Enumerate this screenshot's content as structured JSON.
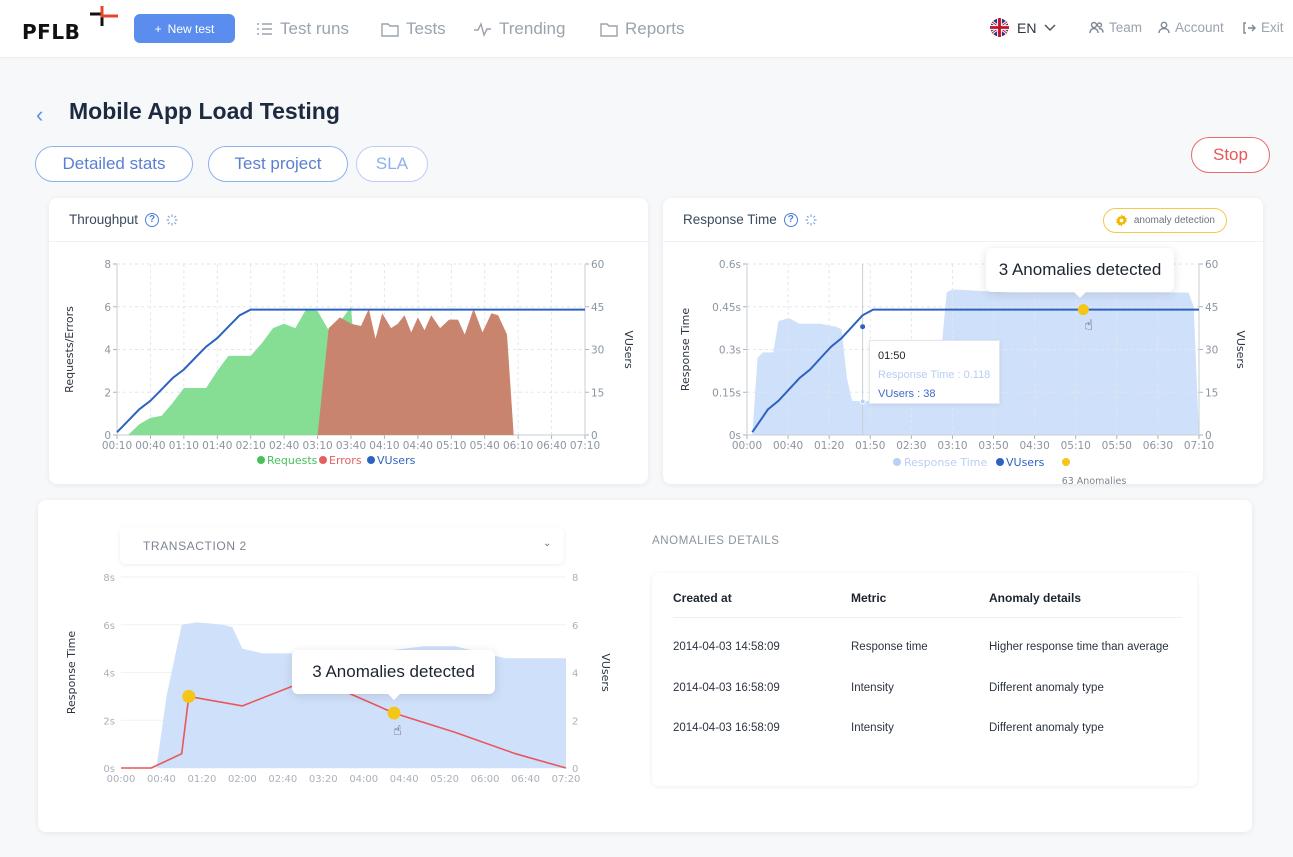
{
  "nav": {
    "logo": "PFLB",
    "new_test_label": "New test",
    "items": [
      {
        "label": "Test runs",
        "icon": "list-icon"
      },
      {
        "label": "Tests",
        "icon": "folder-icon"
      },
      {
        "label": "Trending",
        "icon": "pulse-icon"
      },
      {
        "label": "Reports",
        "icon": "folder-icon"
      }
    ],
    "language": "EN",
    "right_items": [
      {
        "label": "Team",
        "icon": "team-icon"
      },
      {
        "label": "Account",
        "icon": "user-icon"
      },
      {
        "label": "Exit",
        "icon": "exit-icon"
      }
    ]
  },
  "header": {
    "title": "Mobile App Load Testing",
    "tabs": [
      "Detailed stats",
      "Test project",
      "SLA"
    ],
    "stop_label": "Stop"
  },
  "throughput_card": {
    "title": "Throughput",
    "help": "?"
  },
  "response_card": {
    "title": "Response Time",
    "help": "?",
    "anomaly_badge": "anomaly detection",
    "anomalies_popup": "3 Anomalies detected",
    "tooltip": {
      "time": "01:50",
      "response_time": "Response Time : 0.118",
      "vusers": "VUsers : 38"
    },
    "anomalies_count_label": "63 Anomalies"
  },
  "transaction_card": {
    "selected_transaction": "TRANSACTION 2",
    "anomalies_popup": "3 Anomalies detected"
  },
  "anomalies_details": {
    "title": "ANOMALIES DETAILS",
    "columns": [
      "Created at",
      "Metric",
      "Anomaly details"
    ],
    "rows": [
      [
        "2014-04-03 14:58:09",
        "Response time",
        "Higher response time than average"
      ],
      [
        "2014-04-03 16:58:09",
        "Intensity",
        "Different anomaly type"
      ],
      [
        "2014-04-03 16:58:09",
        "Intensity",
        "Different anomaly type"
      ]
    ]
  },
  "colors": {
    "accent": "#5b8def",
    "requests": "#7fdc8f",
    "errors": "#c8846c",
    "vusers": "#2d63c0",
    "response_area": "#cfe0fa",
    "anomaly": "#f5c518",
    "stop": "#e65757",
    "transaction_line": "#e8575a"
  },
  "chart_data": [
    {
      "type": "area",
      "title": "Throughput",
      "xlabel": "",
      "ylabel": "Requests/Errors",
      "y2label": "VUsers",
      "ylim": [
        0,
        8
      ],
      "y2lim": [
        0,
        60
      ],
      "yticks": [
        "0",
        "2",
        "4",
        "6",
        "8"
      ],
      "y2ticks": [
        "0",
        "15",
        "30",
        "45",
        "60"
      ],
      "xticks": [
        "00:10",
        "00:40",
        "01:10",
        "01:40",
        "02:10",
        "02:40",
        "03:10",
        "03:40",
        "04:10",
        "04:40",
        "05:10",
        "05:40",
        "06:10",
        "06:40",
        "07:10"
      ],
      "x_minutes_range": [
        10,
        430
      ],
      "legend": [
        "Requests",
        "Errors",
        "VUsers"
      ],
      "legend_position": "bottom",
      "series": [
        {
          "name": "Requests",
          "axis": "left",
          "x": [
            20,
            30,
            40,
            50,
            60,
            70,
            80,
            90,
            100,
            110,
            120,
            130,
            140,
            150,
            160,
            170,
            180,
            190,
            200,
            210,
            220,
            229
          ],
          "values": [
            0,
            0.5,
            0.8,
            0.9,
            1.5,
            2.2,
            2.2,
            2.2,
            3.0,
            3.7,
            3.7,
            3.7,
            4.3,
            5.0,
            5.2,
            5.0,
            5.9,
            5.8,
            4.9,
            5.3,
            6.0,
            0
          ]
        },
        {
          "name": "Errors",
          "axis": "left",
          "x": [
            190,
            200,
            210,
            220,
            229,
            236,
            242,
            248,
            256,
            262,
            268,
            274,
            280,
            286,
            292,
            300,
            308,
            316,
            322,
            330,
            338,
            346,
            352,
            360,
            366,
            374,
            382,
            390,
            398,
            404,
            410,
            418,
            426
          ],
          "values": [
            0,
            5.0,
            5.5,
            5.2,
            5.1,
            5.9,
            4.5,
            5.7,
            5.0,
            5.2,
            5.6,
            4.8,
            5.5,
            4.9,
            5.6,
            5.0,
            5.4,
            5.4,
            4.7,
            5.9,
            4.8,
            5.7,
            5.6,
            4.7,
            0,
            0,
            0,
            0,
            0,
            0,
            0,
            0,
            0
          ]
        },
        {
          "name": "VUsers",
          "axis": "right",
          "x": [
            10,
            20,
            30,
            40,
            50,
            60,
            70,
            80,
            90,
            100,
            110,
            120,
            130,
            140,
            160,
            430
          ],
          "values": [
            1,
            5,
            9,
            12,
            16,
            20,
            23,
            27,
            31,
            34,
            38,
            42,
            44,
            44,
            44,
            44
          ]
        }
      ]
    },
    {
      "type": "area",
      "title": "Response Time",
      "ylabel": "Response Time",
      "y2label": "VUsers",
      "ylim": [
        0,
        0.6
      ],
      "y2lim": [
        0,
        60
      ],
      "yticks": [
        "0s",
        "0.15s",
        "0.3s",
        "0.45s",
        "0.6s"
      ],
      "y2ticks": [
        "0",
        "15",
        "30",
        "45",
        "60"
      ],
      "xticks": [
        "00:00",
        "00:40",
        "01:20",
        "01:50",
        "02:30",
        "03:10",
        "03:50",
        "04:30",
        "05:10",
        "05:50",
        "06:30",
        "07:10"
      ],
      "legend": [
        "Response Time",
        "VUsers",
        "63 Anomalies"
      ],
      "legend_position": "bottom",
      "series": [
        {
          "name": "Response Time",
          "axis": "left",
          "x": [
            5,
            10,
            15,
            25,
            30,
            40,
            50,
            70,
            85,
            90,
            95,
            100,
            110,
            120,
            140,
            160,
            180,
            190,
            195,
            200,
            250,
            300,
            350,
            400,
            420,
            425,
            430
          ],
          "values": [
            0,
            0.27,
            0.29,
            0.29,
            0.4,
            0.41,
            0.39,
            0.39,
            0.38,
            0.37,
            0.2,
            0.12,
            0.118,
            0.12,
            0.12,
            0.11,
            0.11,
            0.5,
            0.51,
            0.51,
            0.5,
            0.5,
            0.5,
            0.5,
            0.5,
            0.45,
            0
          ]
        },
        {
          "name": "VUsers",
          "axis": "right",
          "x": [
            5,
            20,
            30,
            40,
            50,
            60,
            70,
            80,
            90,
            100,
            110,
            120,
            125,
            430
          ],
          "values": [
            1,
            9,
            12,
            16,
            20,
            23,
            27,
            31,
            34,
            38,
            42,
            44,
            44,
            44
          ]
        }
      ],
      "anomaly_points": [
        {
          "x": 320,
          "value": 44
        }
      ]
    },
    {
      "type": "line",
      "title": "TRANSACTION 2",
      "ylabel": "Response Time",
      "y2label": "VUsers",
      "ylim": [
        0,
        8
      ],
      "y2lim": [
        0,
        8
      ],
      "yticks": [
        "0s",
        "2s",
        "4s",
        "6s",
        "8s"
      ],
      "y2ticks": [
        "0",
        "2",
        "4",
        "6",
        "8"
      ],
      "xticks": [
        "00:00",
        "00:40",
        "01:20",
        "02:00",
        "02:40",
        "03:20",
        "04:00",
        "04:40",
        "05:20",
        "06:00",
        "06:40",
        "07:20"
      ],
      "series": [
        {
          "name": "VUsers",
          "axis": "right",
          "type": "area",
          "x": [
            0,
            35,
            45,
            60,
            75,
            90,
            100,
            110,
            120,
            140,
            180,
            240,
            300,
            330,
            360,
            380,
            400,
            440
          ],
          "values": [
            0,
            0,
            3,
            6,
            6.1,
            6.05,
            6.0,
            5.9,
            5.0,
            4.8,
            4.8,
            4.8,
            5.1,
            5.1,
            4.8,
            4.6,
            4.6,
            4.6
          ]
        },
        {
          "name": "Response Time",
          "axis": "left",
          "type": "line",
          "x": [
            0,
            30,
            60,
            67,
            120,
            180,
            200,
            270,
            330,
            390,
            440
          ],
          "values": [
            0,
            0,
            0.6,
            3.0,
            2.6,
            3.6,
            3.6,
            2.3,
            1.5,
            0.6,
            0
          ]
        }
      ],
      "anomaly_points": [
        {
          "x": 67,
          "value": 3.0
        },
        {
          "x": 270,
          "value": 2.3
        }
      ]
    }
  ]
}
